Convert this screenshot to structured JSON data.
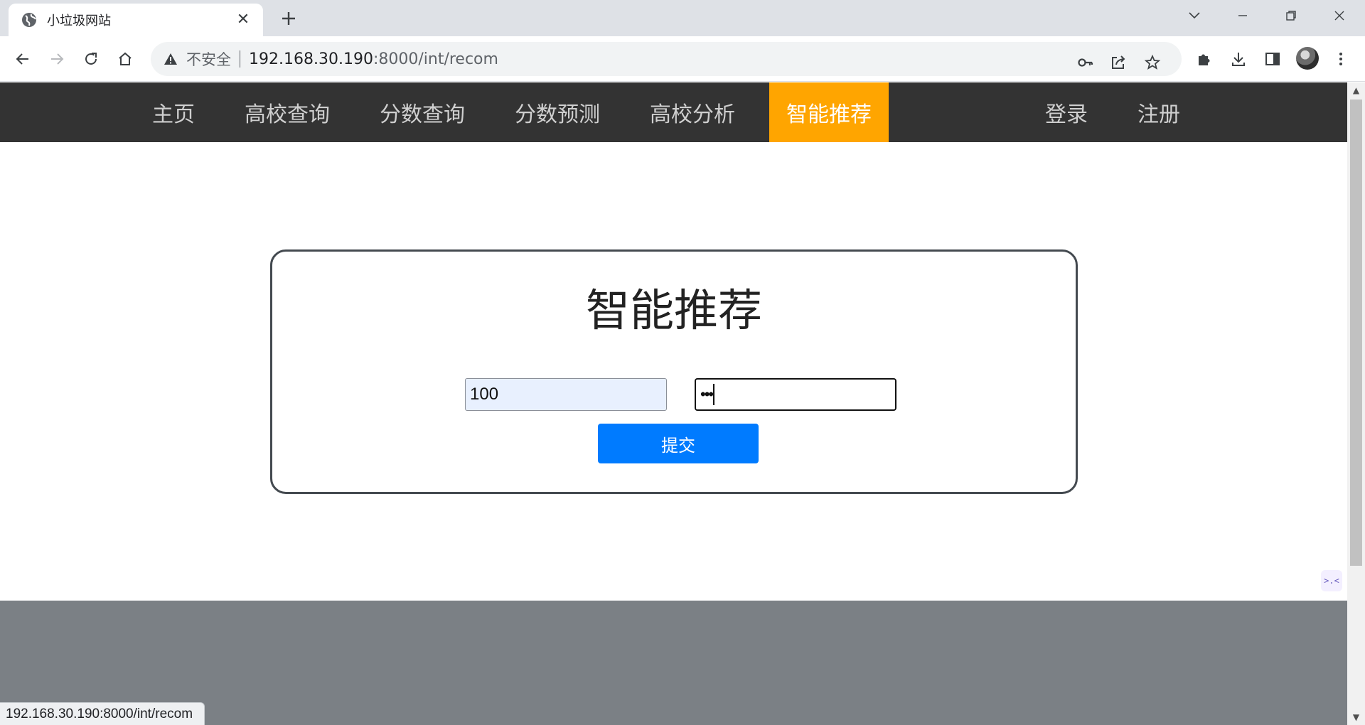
{
  "browser": {
    "tab_title": "小垃圾网站",
    "security_label": "不安全",
    "url_host": "192.168.30.190",
    "url_rest": ":8000/int/recom",
    "status_url": "192.168.30.190:8000/int/recom"
  },
  "nav": {
    "items": [
      {
        "label": "主页"
      },
      {
        "label": "高校查询"
      },
      {
        "label": "分数查询"
      },
      {
        "label": "分数预测"
      },
      {
        "label": "高校分析"
      },
      {
        "label": "智能推荐"
      }
    ],
    "login": "登录",
    "register": "注册",
    "active_color": "#ffa500"
  },
  "form": {
    "title": "智能推荐",
    "score_value": "100",
    "rank_value_masked": "•••",
    "submit_label": "提交",
    "submit_color": "#007bff"
  },
  "colors": {
    "navbar": "#333333",
    "footer": "#7b8085"
  }
}
